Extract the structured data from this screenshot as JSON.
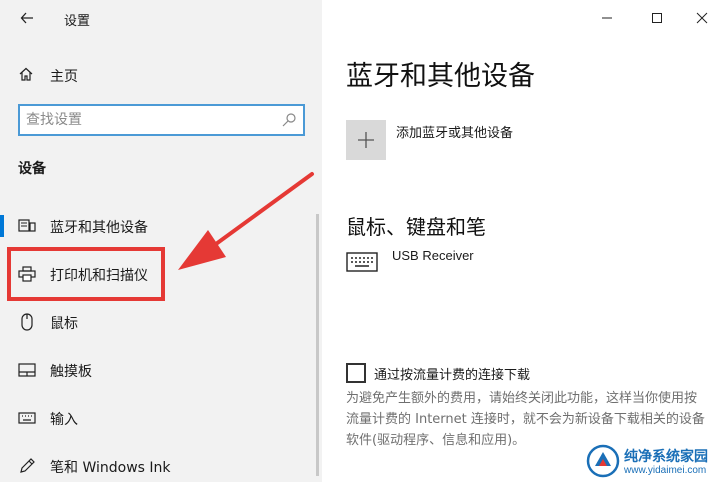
{
  "window": {
    "title": "设置"
  },
  "sidebar": {
    "home_label": "主页",
    "search": {
      "placeholder": "查找设置",
      "value": ""
    },
    "section_title": "设备",
    "items": [
      {
        "label": "蓝牙和其他设备",
        "icon": "bluetooth-devices-icon",
        "selected": true
      },
      {
        "label": "打印机和扫描仪",
        "icon": "printer-icon",
        "selected": false
      },
      {
        "label": "鼠标",
        "icon": "mouse-icon",
        "selected": false
      },
      {
        "label": "触摸板",
        "icon": "touchpad-icon",
        "selected": false
      },
      {
        "label": "输入",
        "icon": "keyboard-icon",
        "selected": false
      },
      {
        "label": "笔和 Windows Ink",
        "icon": "pen-icon",
        "selected": false
      }
    ]
  },
  "main": {
    "heading": "蓝牙和其他设备",
    "add_device_label": "添加蓝牙或其他设备",
    "mouse_keyboard_heading": "鼠标、键盘和笔",
    "devices": [
      {
        "name": "USB Receiver",
        "icon": "keyboard-device-icon"
      }
    ],
    "metered_checkbox": {
      "label": "通过按流量计费的连接下载",
      "checked": false,
      "description": "为避免产生额外的费用，请始终关闭此功能，这样当你使用按流量计费的 Internet 连接时，就不会为新设备下载相关的设备软件(驱动程序、信息和应用)。"
    }
  },
  "annotation": {
    "highlight_color": "#e53935",
    "arrow_color": "#e53935"
  },
  "watermark": {
    "name": "纯净系统家园",
    "url": "www.yidaimei.com"
  },
  "colors": {
    "accent": "#0078d7",
    "sidebar_bg": "#f2f2f2",
    "search_border": "#4b9ad6"
  }
}
